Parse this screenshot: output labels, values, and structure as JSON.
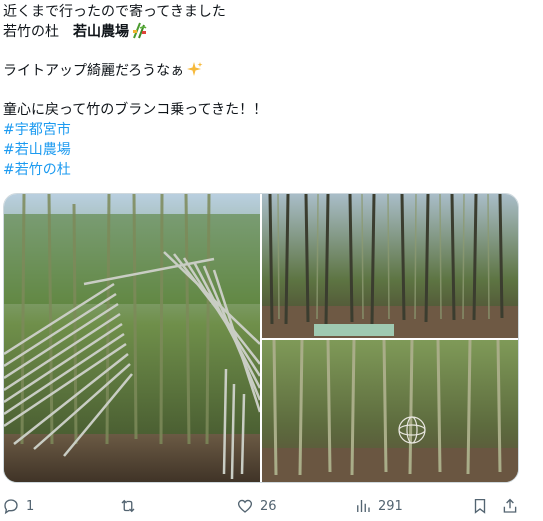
{
  "tweet": {
    "lines": [
      "近くまで行ったので寄ってきました",
      "若竹の杜　",
      "若山農場",
      "ライトアップ綺麗だろうなぁ",
      "童心に戻って竹のブランコ乗ってきた！！"
    ],
    "hashtags": [
      "#宇都宮市",
      "#若山農場",
      "#若竹の杜"
    ],
    "emojis": [
      "bamboo-decoration-emoji",
      "sparkles-emoji"
    ]
  },
  "media": {
    "photos": [
      "bamboo-arch-swing-photo",
      "bamboo-forest-path-photo",
      "bamboo-grove-photo"
    ]
  },
  "actions": {
    "reply_count": "1",
    "retweet_count": "",
    "like_count": "26",
    "view_count": "291"
  },
  "icons": {
    "reply": "reply-icon",
    "retweet": "retweet-icon",
    "like": "heart-icon",
    "views": "views-chart-icon",
    "bookmark": "bookmark-icon",
    "share": "share-icon"
  },
  "colors": {
    "text": "#0f1419",
    "hashtag": "#1d9bf0",
    "muted": "#536471",
    "border": "#cfd9de"
  }
}
